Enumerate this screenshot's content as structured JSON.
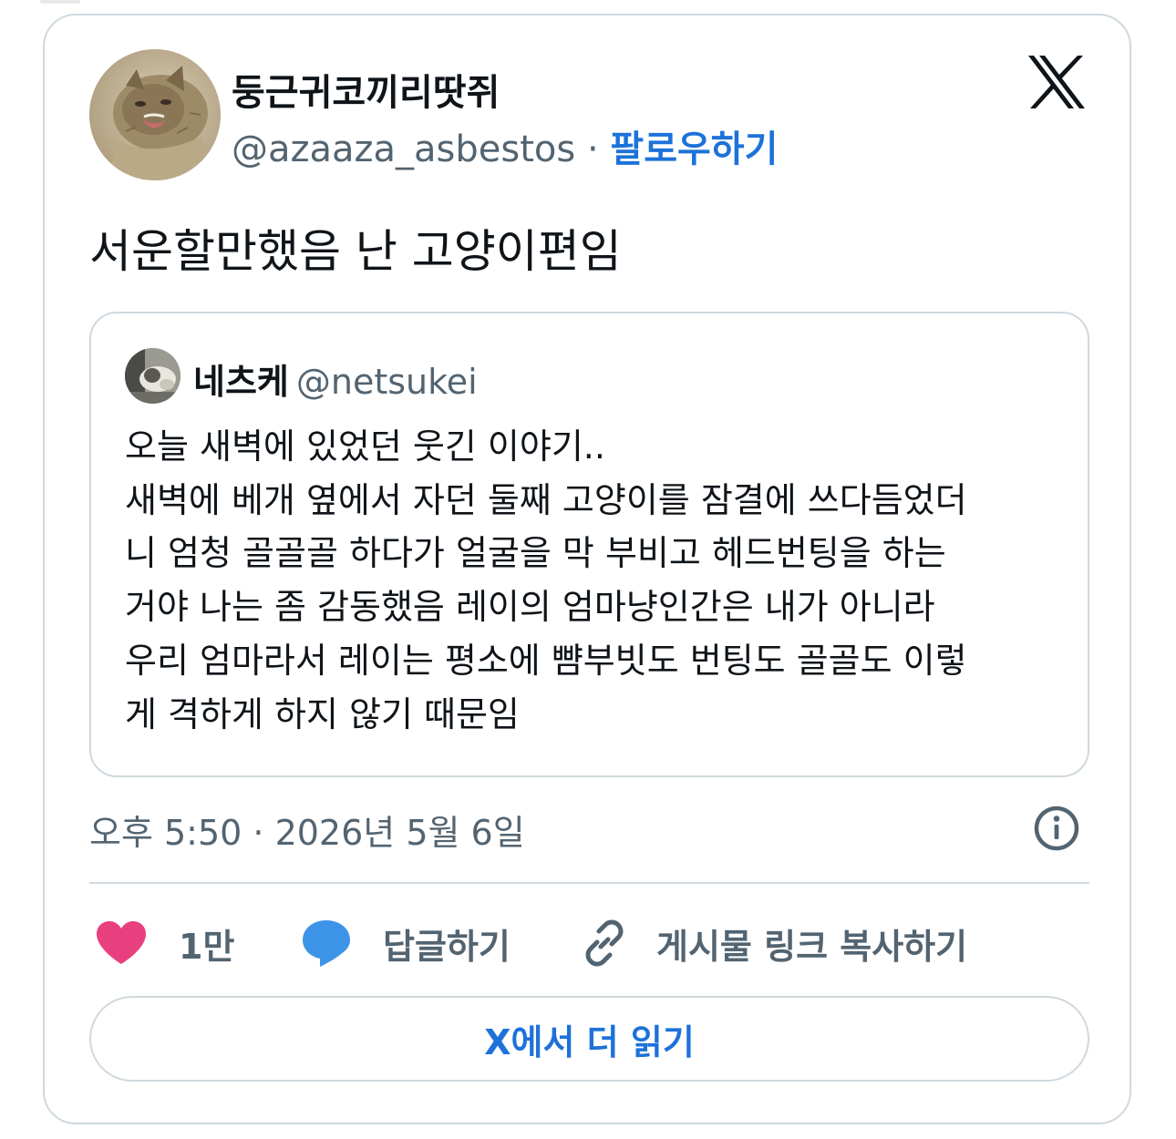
{
  "tweet": {
    "author": {
      "display_name": "둥근귀코끼리땃쥐",
      "handle": "@azaaza_asbestos",
      "separator": " · ",
      "follow_label": "팔로우하기"
    },
    "text": "서운할만했음 난 고양이편임",
    "quoted": {
      "display_name": "네츠케",
      "handle": "@netsukei",
      "lines": [
        "오늘 새벽에 있었던 웃긴 이야기..",
        "새벽에 베개 옆에서 자던 둘째 고양이를 잠결에 쓰다듬었더",
        "니 엄청 골골골 하다가 얼굴을 막 부비고 헤드번팅을 하는",
        "거야 나는 좀 감동했음 레이의 엄마냥인간은 내가 아니라",
        "우리 엄마라서 레이는 평소에 뺨부빗도 번팅도 골골도 이렇",
        "게 격하게 하지 않기 때문임"
      ]
    },
    "timestamp": "오후 5:50 · 2026년 5월 6일",
    "actions": {
      "like_count": "1만",
      "reply_label": "답글하기",
      "copy_link_label": "게시물 링크 복사하기"
    },
    "read_more_label": "X에서 더 읽기"
  },
  "icons": {
    "brand": "x-logo-icon",
    "info": "info-icon",
    "like": "heart-icon",
    "reply": "speech-bubble-icon",
    "link": "link-icon"
  },
  "colors": {
    "link_blue": "#1d72d9",
    "heart": "#e8407e",
    "reply_blue": "#3d93e8",
    "muted_text": "#536471",
    "border": "#cfd9de",
    "text": "#0f1419"
  }
}
